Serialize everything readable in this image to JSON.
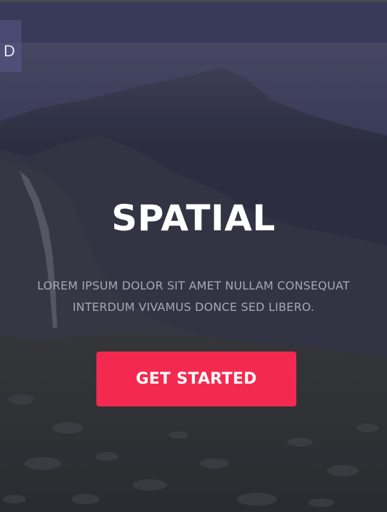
{
  "hero": {
    "title": "SPATIAL",
    "subtitle": "LOREM IPSUM DOLOR SIT AMET NULLAM CONSEQUAT INTERDUM VIVAMUS DONCE SED LIBERO.",
    "cta_label": "GET STARTED"
  },
  "nav": {
    "tab_label": "D"
  },
  "colors": {
    "accent": "#f4294f",
    "title_text": "#ffffff",
    "subtitle_text": "#a6a8b6",
    "overlay": "#3b3c55"
  }
}
